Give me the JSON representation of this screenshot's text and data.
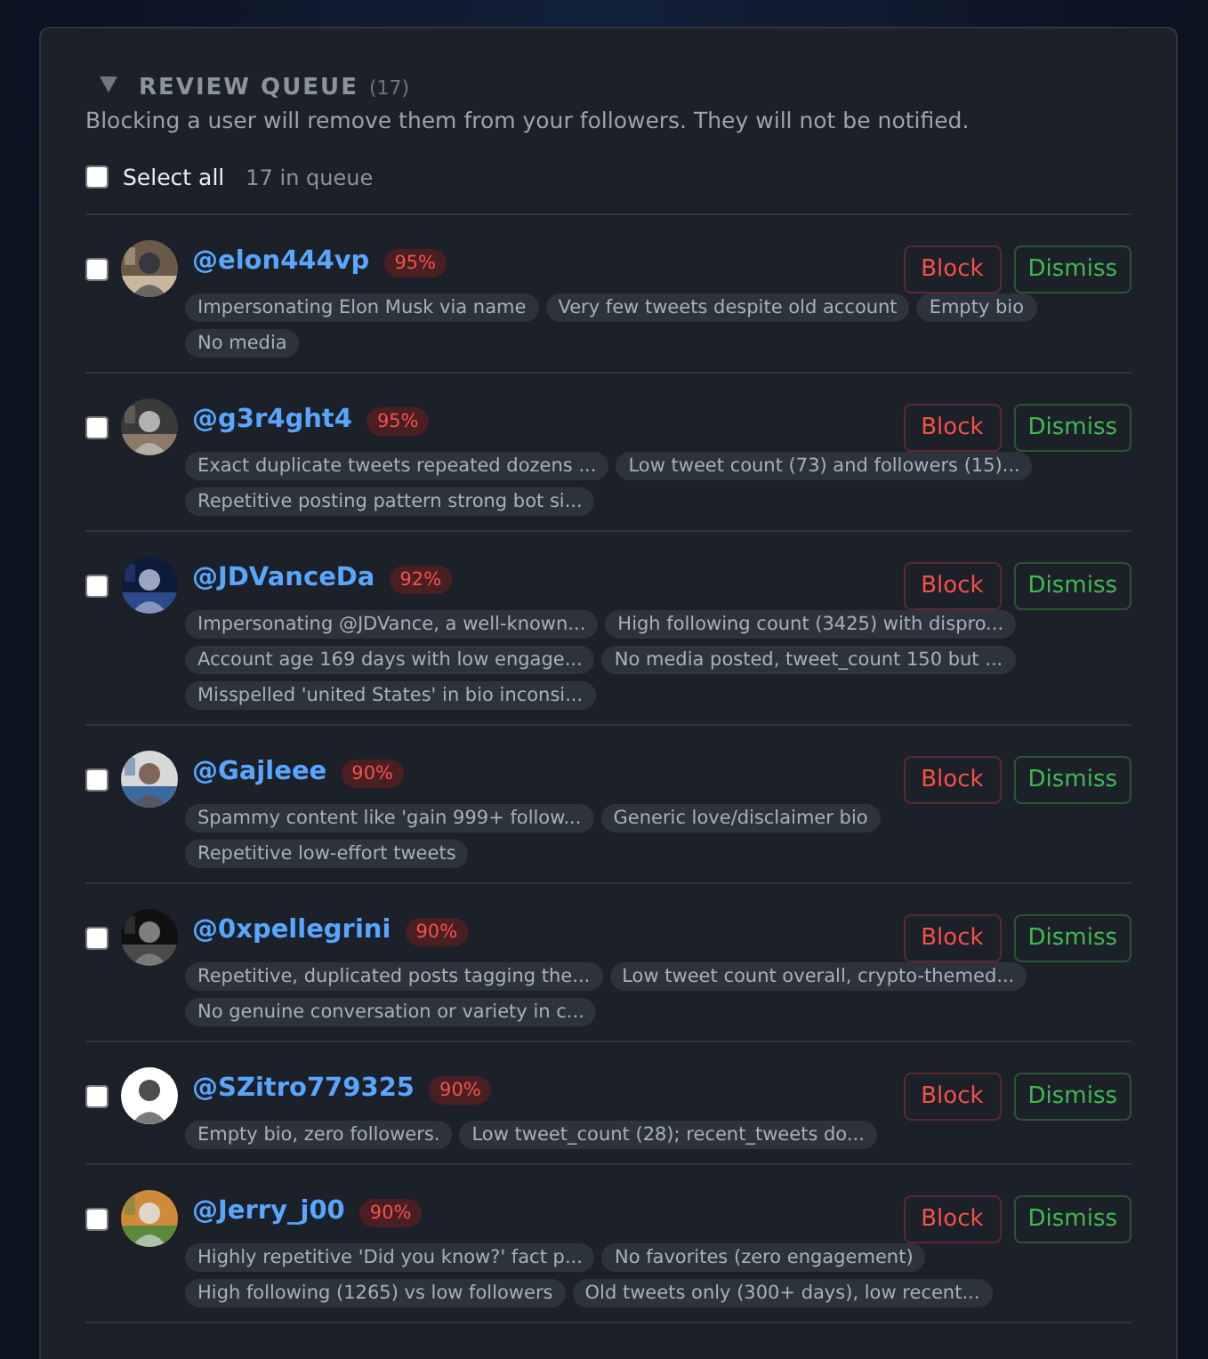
{
  "queue": {
    "expanded": true,
    "title": "REVIEW QUEUE",
    "count": "(17)",
    "note": "Blocking a user will remove them from your followers. They will not be notified.",
    "select_all": {
      "label": "Select all",
      "checked": false
    },
    "in_queue": "17 in queue"
  },
  "accounts": [
    {
      "handle": "@elon444vp",
      "score": "95%",
      "checked": false,
      "avatar": {
        "kind": "picture"
      },
      "reasons": [
        "Impersonating Elon Musk via name",
        "Very few tweets despite old account",
        "Empty bio",
        "No media"
      ],
      "actions": [
        "Block",
        "Dismiss"
      ]
    },
    {
      "handle": "@g3r4ght4",
      "score": "95%",
      "checked": false,
      "avatar": {
        "kind": "picture"
      },
      "reasons": [
        "Exact duplicate tweets repeated dozens ...",
        "Low tweet count (73) and followers (15)...",
        "Repetitive posting pattern strong bot si..."
      ],
      "actions": [
        "Block",
        "Dismiss"
      ]
    },
    {
      "handle": "@JDVanceDa",
      "score": "92%",
      "checked": false,
      "avatar": {
        "kind": "picture"
      },
      "reasons": [
        "Impersonating @JDVance, a well-known...",
        "High following count (3425) with dispro...",
        "Account age 169 days with low engage...",
        "No media posted, tweet_count 150 but ...",
        "Misspelled 'united States' in bio inconsi..."
      ],
      "actions": [
        "Block",
        "Dismiss"
      ]
    },
    {
      "handle": "@Gajleee",
      "score": "90%",
      "checked": false,
      "avatar": {
        "kind": "picture"
      },
      "reasons": [
        "Spammy content like 'gain 999+ follow...",
        "Generic love/disclaimer bio",
        "Repetitive low-effort tweets"
      ],
      "actions": [
        "Block",
        "Dismiss"
      ]
    },
    {
      "handle": "@0xpellegrini",
      "score": "90%",
      "checked": false,
      "avatar": {
        "kind": "picture"
      },
      "reasons": [
        "Repetitive, duplicated posts tagging the...",
        "Low tweet count overall, crypto-themed...",
        "No genuine conversation or variety in c..."
      ],
      "actions": [
        "Block",
        "Dismiss"
      ]
    },
    {
      "handle": "@SZitro779325",
      "score": "90%",
      "checked": false,
      "avatar": {
        "kind": "picture"
      },
      "reasons": [
        "Empty bio, zero followers.",
        "Low tweet_count (28); recent_tweets do..."
      ],
      "actions": [
        "Block",
        "Dismiss"
      ]
    },
    {
      "handle": "@Jerry_j00",
      "score": "90%",
      "checked": false,
      "avatar": {
        "kind": "picture"
      },
      "reasons": [
        "Highly repetitive 'Did you know?' fact p...",
        "No favorites (zero engagement)",
        "High following (1265) vs low followers",
        "Old tweets only (300+ days), low recent..."
      ],
      "actions": [
        "Block",
        "Dismiss"
      ]
    }
  ]
}
